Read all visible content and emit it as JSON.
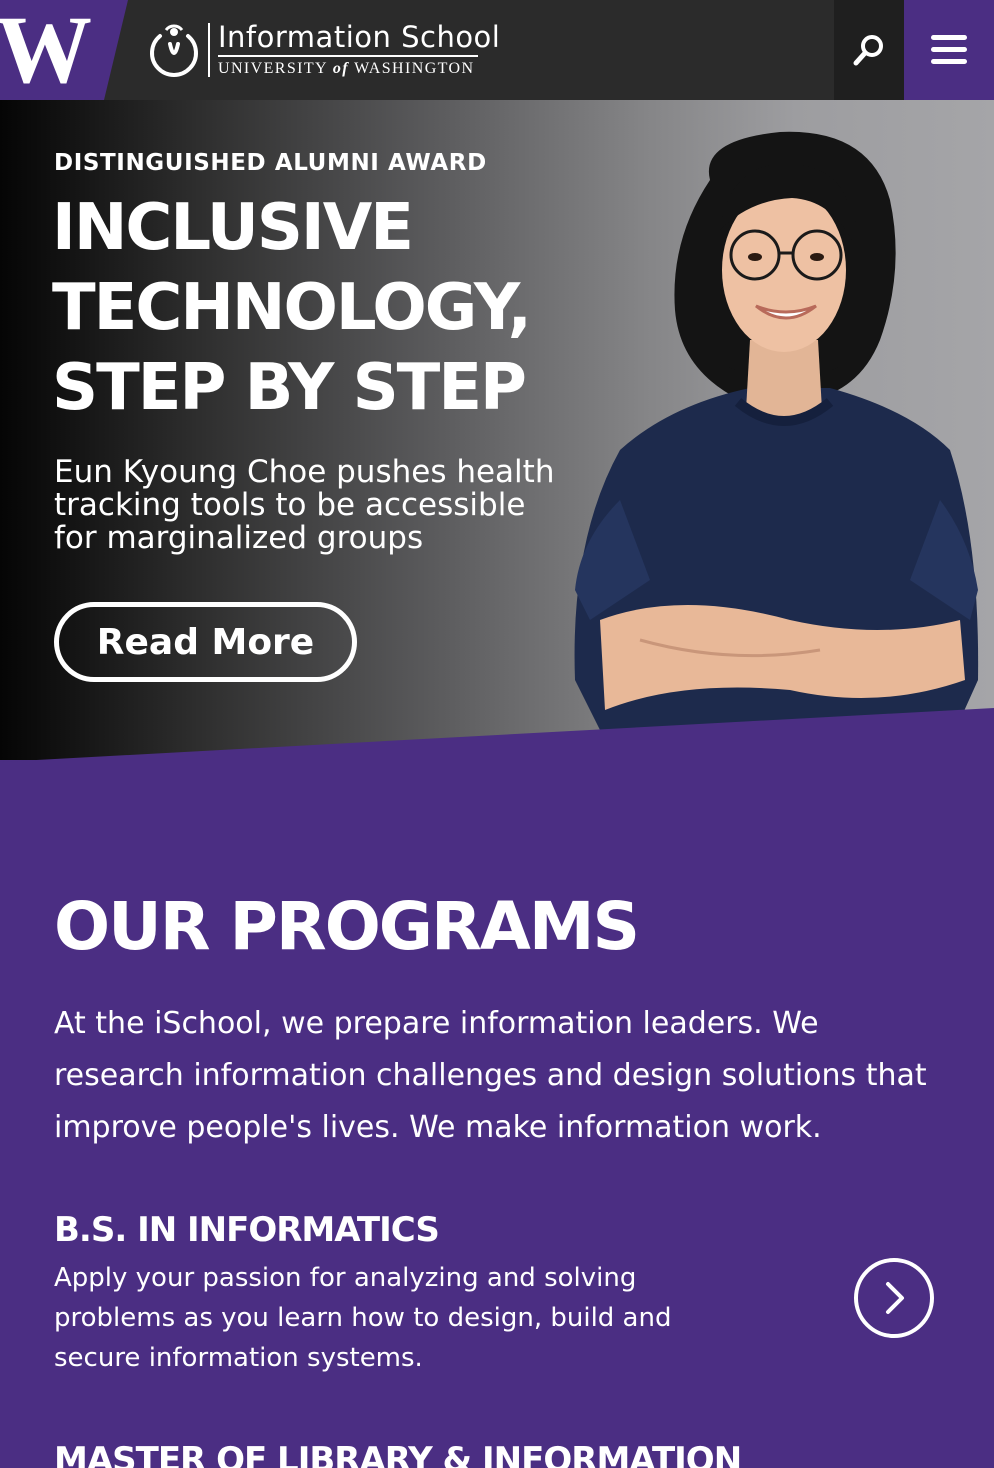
{
  "header": {
    "logo_letter": "W",
    "brand_name": "Information School",
    "brand_sub_prefix": "UNIVERSITY",
    "brand_sub_of": "of",
    "brand_sub_suffix": "WASHINGTON",
    "search_icon": "search-icon",
    "menu_icon": "hamburger-menu-icon"
  },
  "hero": {
    "eyebrow": "DISTINGUISHED ALUMNI AWARD",
    "title_lines": [
      "INCLUSIVE",
      "TECHNOLOGY,",
      "STEP BY STEP"
    ],
    "subtitle": "Eun Kyoung Choe pushes health tracking tools to be accessible for marginalized groups",
    "cta_label": "Read More"
  },
  "programs": {
    "title": "OUR PROGRAMS",
    "intro": "At the iSchool, we prepare information leaders. We research information challenges and design solutions that improve people's lives. We make information work.",
    "items": [
      {
        "title": "B.S. IN INFORMATICS",
        "description": "Apply your passion for analyzing and solving problems as you learn how to design, build and secure information systems.",
        "arrow_icon": "chevron-right-circle-icon"
      },
      {
        "title": "MASTER OF LIBRARY & INFORMATION"
      }
    ]
  },
  "colors": {
    "uw_purple": "#4b2e83",
    "header_dark": "#2b2b2b",
    "search_bg": "#1f1f1f",
    "white": "#ffffff"
  }
}
